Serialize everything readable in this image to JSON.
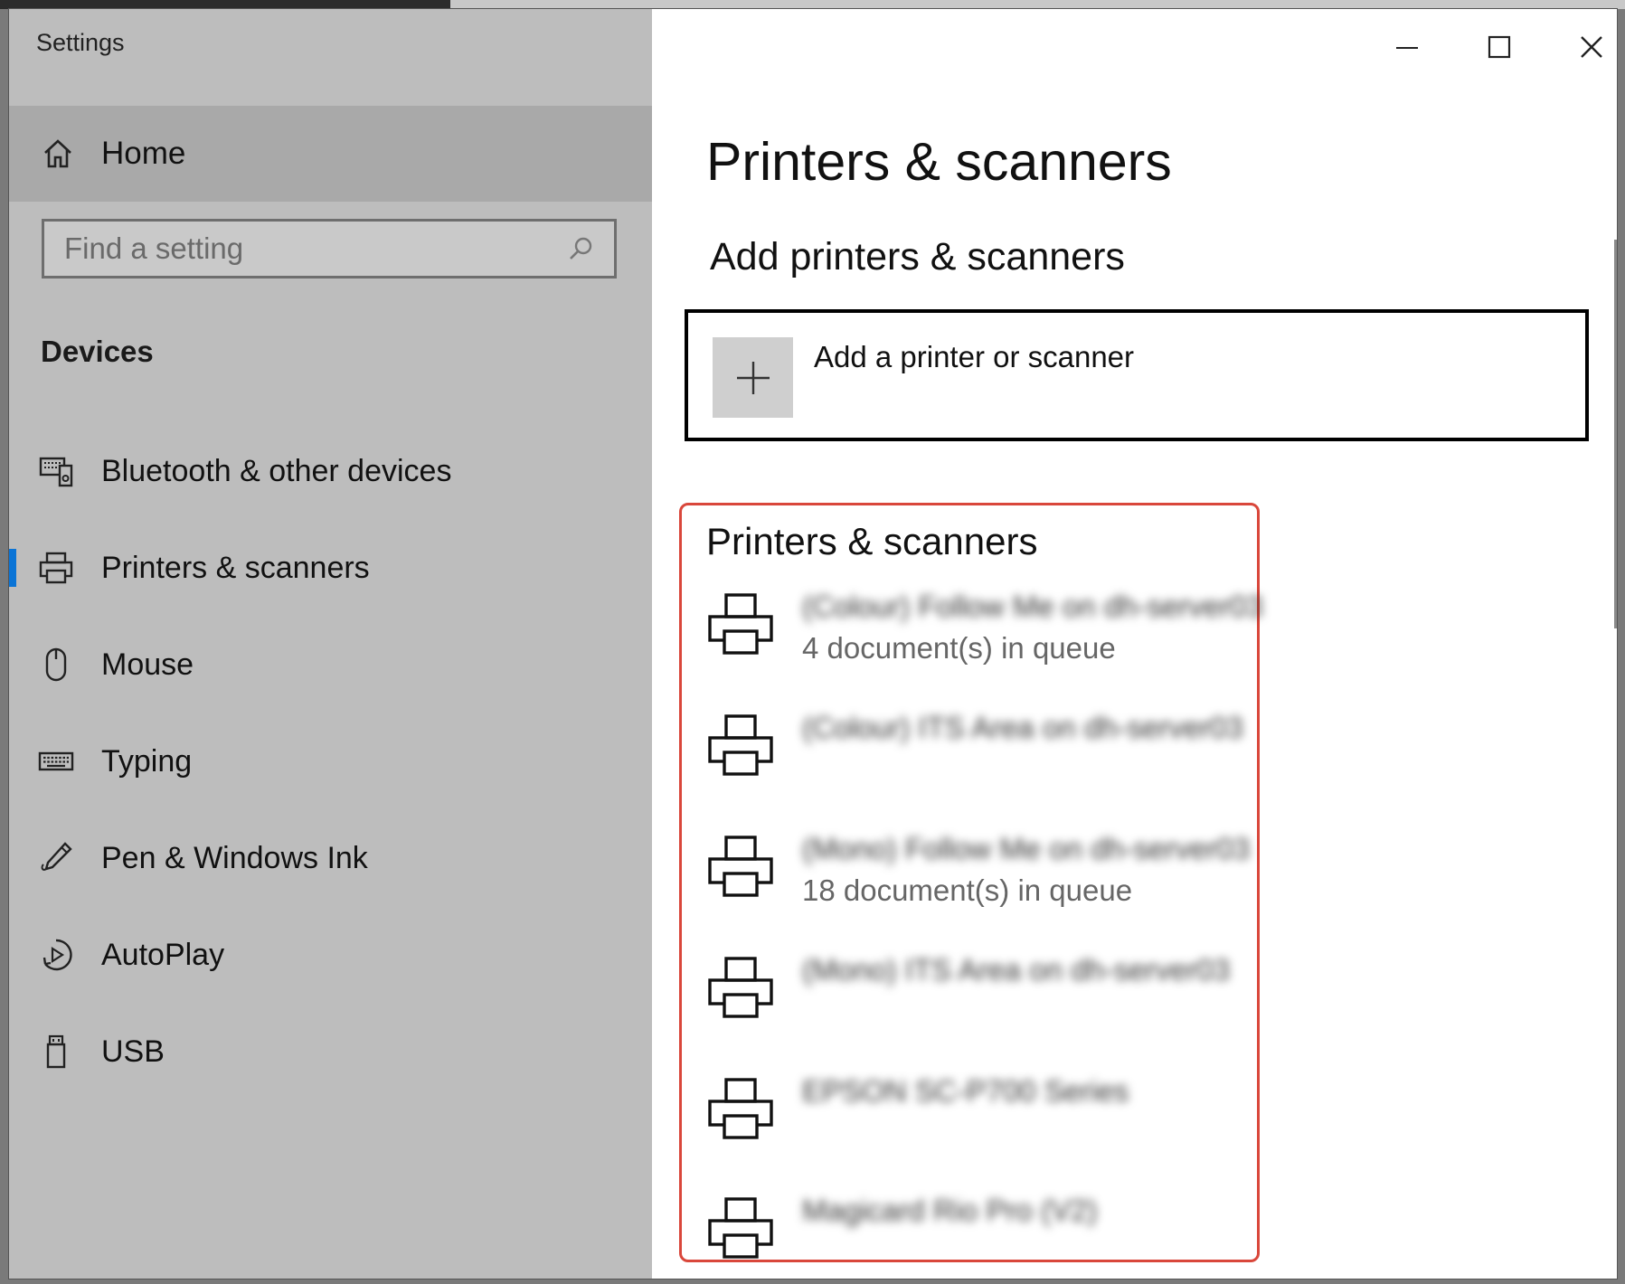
{
  "window": {
    "title": "Settings"
  },
  "sidebar": {
    "home_label": "Home",
    "search_placeholder": "Find a setting",
    "section_heading": "Devices",
    "items": [
      {
        "label": "Bluetooth & other devices",
        "icon": "bluetooth-devices-icon"
      },
      {
        "label": "Printers & scanners",
        "icon": "printer-icon",
        "selected": true
      },
      {
        "label": "Mouse",
        "icon": "mouse-icon"
      },
      {
        "label": "Typing",
        "icon": "keyboard-icon"
      },
      {
        "label": "Pen & Windows Ink",
        "icon": "pen-icon"
      },
      {
        "label": "AutoPlay",
        "icon": "autoplay-icon"
      },
      {
        "label": "USB",
        "icon": "usb-icon"
      }
    ]
  },
  "content": {
    "page_title": "Printers & scanners",
    "add_section_heading": "Add printers & scanners",
    "add_button_label": "Add a printer or scanner",
    "printers_heading": "Printers & scanners",
    "printers": [
      {
        "name": "(Colour) Follow Me on dh-server03",
        "status": "4 document(s) in queue",
        "blurred": true
      },
      {
        "name": "(Colour) ITS Area on dh-server03",
        "status": "",
        "blurred": true
      },
      {
        "name": "(Mono) Follow Me on dh-server03",
        "status": "18 document(s) in queue",
        "blurred": true
      },
      {
        "name": "(Mono) ITS Area on dh-server03",
        "status": "",
        "blurred": true
      },
      {
        "name": "EPSON SC-P700 Series",
        "status": "",
        "blurred": true
      },
      {
        "name": "Magicard Rio Pro (V2)",
        "status": "",
        "blurred": true
      }
    ]
  },
  "colors": {
    "accent": "#0a74d6",
    "highlight_border": "#d9473b",
    "sidebar_bg": "#bdbdbd"
  }
}
